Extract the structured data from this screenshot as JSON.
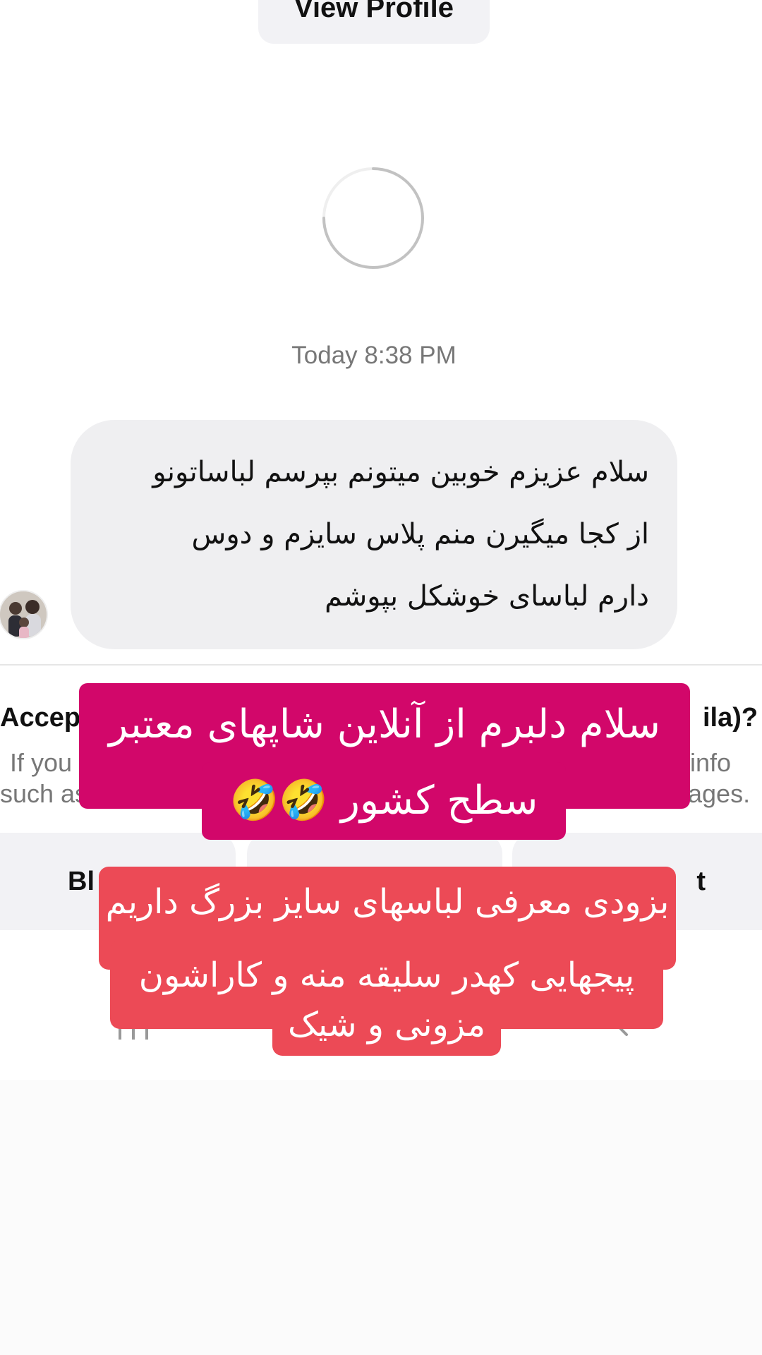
{
  "header": {
    "view_profile_label": "View Profile"
  },
  "thread": {
    "timestamp": "Today 8:38 PM",
    "message_lines": [
      "سلام عزیزم خوبین میتونم بپرسم لباساتونو",
      "از کجا میگیرن منم پلاس سایزم و دوس",
      "دارم لباسای خوشکل بپوشم"
    ]
  },
  "request_panel": {
    "title_left": "Accep",
    "title_right": "ila)?",
    "body_left_line1": "If you",
    "body_left_line2": "such as",
    "body_right_line1": "info",
    "body_right_line2": "ages.",
    "buttons": {
      "left": "Bl",
      "right": "t"
    }
  },
  "overlay_captions": {
    "caption1_line1": "سلام دلبرم از آنلاین شاپهای معتبر",
    "caption1_line2": "سطح کشور 🤣🤣",
    "caption2_line1": "بزودی معرفی لباسهای سایز بزرگ داریم",
    "caption2_line2": "پیجهایی کهدر سلیقه منه و کاراشون",
    "caption2_line3": "مزونی و شیک"
  },
  "icons": {
    "spinner": "loading-spinner-icon",
    "nav_menu": "recent-apps-icon",
    "nav_back": "back-icon"
  }
}
